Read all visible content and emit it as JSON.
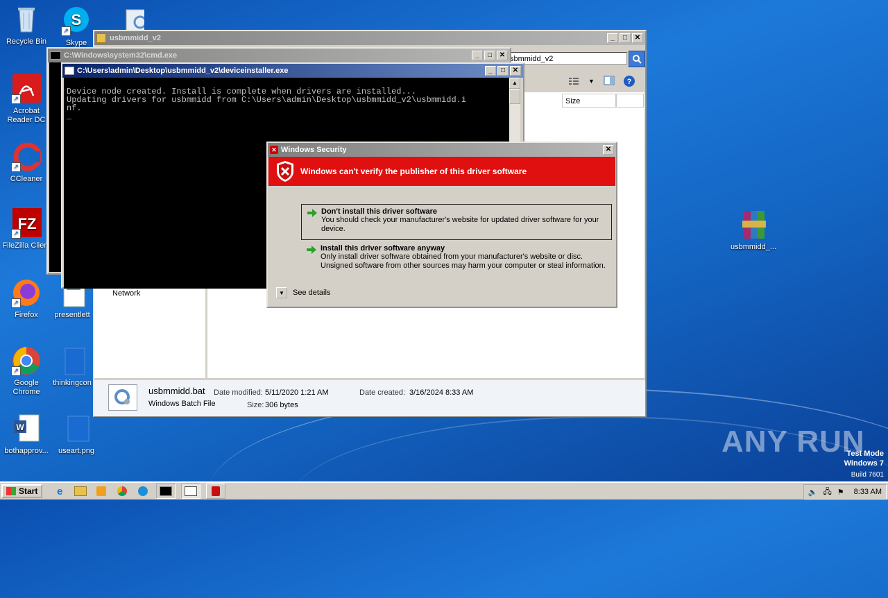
{
  "desktop": {
    "icons": [
      {
        "label": "Recycle Bin"
      },
      {
        "label": "Skype"
      },
      {
        "label": "Acrobat Reader DC"
      },
      {
        "label": "CCleaner"
      },
      {
        "label": "FileZilla Client"
      },
      {
        "label": "Firefox"
      },
      {
        "label": "presentlett"
      },
      {
        "label": "Google Chrome"
      },
      {
        "label": "thinkingcon"
      },
      {
        "label": "bothapprov..."
      },
      {
        "label": "useart.png"
      },
      {
        "label": "usbmmidd_..."
      }
    ]
  },
  "explorer": {
    "title": "usbmmidd_v2",
    "address": "sbmmidd_v2",
    "column_size": "Size",
    "nav_item": "Network",
    "details": {
      "filename": "usbmmidd.bat",
      "filetype": "Windows Batch File",
      "modified_label": "Date modified:",
      "modified_value": "5/11/2020 1:21 AM",
      "size_label": "Size:",
      "size_value": "306 bytes",
      "created_label": "Date created:",
      "created_value": "3/16/2024 8:33 AM"
    }
  },
  "cmd_back": {
    "title": "C:\\Windows\\system32\\cmd.exe"
  },
  "cmd_front": {
    "title": "C:\\Users\\admin\\Desktop\\usbmmidd_v2\\deviceinstaller.exe",
    "lines": [
      "Device node created. Install is complete when drivers are installed...",
      "Updating drivers for usbmmidd from C:\\Users\\admin\\Desktop\\usbmmidd_v2\\usbmmidd.i",
      "nf.",
      "_"
    ]
  },
  "security": {
    "title": "Windows Security",
    "headline": "Windows can't verify the publisher of this driver software",
    "option1_title": "Don't install this driver software",
    "option1_desc": "You should check your manufacturer's website for updated driver software for your device.",
    "option2_title": "Install this driver software anyway",
    "option2_desc": "Only install driver software obtained from your manufacturer's website or disc. Unsigned software from other sources may harm your computer or steal information.",
    "details_label": "See details",
    "banner_color": "#e01010"
  },
  "watermark": {
    "brand": "ANY RUN",
    "mode": "Test Mode",
    "os": "Windows 7",
    "build": "Build 7601"
  },
  "taskbar": {
    "start_label": "Start",
    "clock": "8:33 AM"
  }
}
